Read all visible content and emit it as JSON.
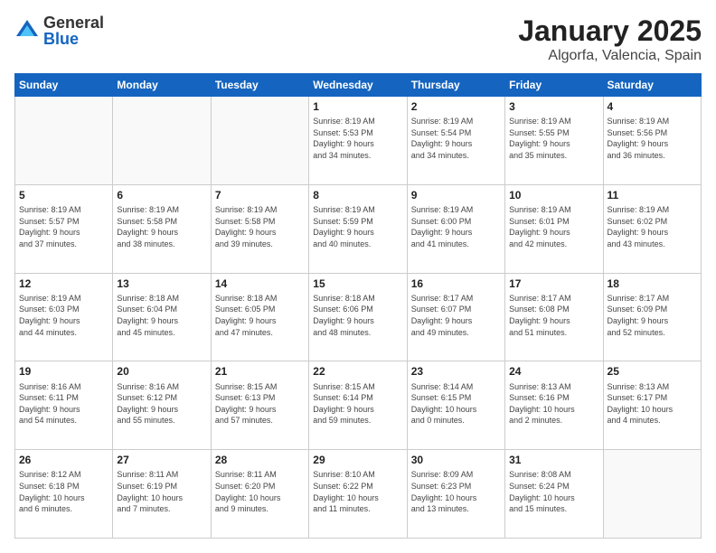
{
  "header": {
    "logo_general": "General",
    "logo_blue": "Blue",
    "month_title": "January 2025",
    "location": "Algorfa, Valencia, Spain"
  },
  "weekdays": [
    "Sunday",
    "Monday",
    "Tuesday",
    "Wednesday",
    "Thursday",
    "Friday",
    "Saturday"
  ],
  "weeks": [
    [
      {
        "day": "",
        "info": ""
      },
      {
        "day": "",
        "info": ""
      },
      {
        "day": "",
        "info": ""
      },
      {
        "day": "1",
        "info": "Sunrise: 8:19 AM\nSunset: 5:53 PM\nDaylight: 9 hours\nand 34 minutes."
      },
      {
        "day": "2",
        "info": "Sunrise: 8:19 AM\nSunset: 5:54 PM\nDaylight: 9 hours\nand 34 minutes."
      },
      {
        "day": "3",
        "info": "Sunrise: 8:19 AM\nSunset: 5:55 PM\nDaylight: 9 hours\nand 35 minutes."
      },
      {
        "day": "4",
        "info": "Sunrise: 8:19 AM\nSunset: 5:56 PM\nDaylight: 9 hours\nand 36 minutes."
      }
    ],
    [
      {
        "day": "5",
        "info": "Sunrise: 8:19 AM\nSunset: 5:57 PM\nDaylight: 9 hours\nand 37 minutes."
      },
      {
        "day": "6",
        "info": "Sunrise: 8:19 AM\nSunset: 5:58 PM\nDaylight: 9 hours\nand 38 minutes."
      },
      {
        "day": "7",
        "info": "Sunrise: 8:19 AM\nSunset: 5:58 PM\nDaylight: 9 hours\nand 39 minutes."
      },
      {
        "day": "8",
        "info": "Sunrise: 8:19 AM\nSunset: 5:59 PM\nDaylight: 9 hours\nand 40 minutes."
      },
      {
        "day": "9",
        "info": "Sunrise: 8:19 AM\nSunset: 6:00 PM\nDaylight: 9 hours\nand 41 minutes."
      },
      {
        "day": "10",
        "info": "Sunrise: 8:19 AM\nSunset: 6:01 PM\nDaylight: 9 hours\nand 42 minutes."
      },
      {
        "day": "11",
        "info": "Sunrise: 8:19 AM\nSunset: 6:02 PM\nDaylight: 9 hours\nand 43 minutes."
      }
    ],
    [
      {
        "day": "12",
        "info": "Sunrise: 8:19 AM\nSunset: 6:03 PM\nDaylight: 9 hours\nand 44 minutes."
      },
      {
        "day": "13",
        "info": "Sunrise: 8:18 AM\nSunset: 6:04 PM\nDaylight: 9 hours\nand 45 minutes."
      },
      {
        "day": "14",
        "info": "Sunrise: 8:18 AM\nSunset: 6:05 PM\nDaylight: 9 hours\nand 47 minutes."
      },
      {
        "day": "15",
        "info": "Sunrise: 8:18 AM\nSunset: 6:06 PM\nDaylight: 9 hours\nand 48 minutes."
      },
      {
        "day": "16",
        "info": "Sunrise: 8:17 AM\nSunset: 6:07 PM\nDaylight: 9 hours\nand 49 minutes."
      },
      {
        "day": "17",
        "info": "Sunrise: 8:17 AM\nSunset: 6:08 PM\nDaylight: 9 hours\nand 51 minutes."
      },
      {
        "day": "18",
        "info": "Sunrise: 8:17 AM\nSunset: 6:09 PM\nDaylight: 9 hours\nand 52 minutes."
      }
    ],
    [
      {
        "day": "19",
        "info": "Sunrise: 8:16 AM\nSunset: 6:11 PM\nDaylight: 9 hours\nand 54 minutes."
      },
      {
        "day": "20",
        "info": "Sunrise: 8:16 AM\nSunset: 6:12 PM\nDaylight: 9 hours\nand 55 minutes."
      },
      {
        "day": "21",
        "info": "Sunrise: 8:15 AM\nSunset: 6:13 PM\nDaylight: 9 hours\nand 57 minutes."
      },
      {
        "day": "22",
        "info": "Sunrise: 8:15 AM\nSunset: 6:14 PM\nDaylight: 9 hours\nand 59 minutes."
      },
      {
        "day": "23",
        "info": "Sunrise: 8:14 AM\nSunset: 6:15 PM\nDaylight: 10 hours\nand 0 minutes."
      },
      {
        "day": "24",
        "info": "Sunrise: 8:13 AM\nSunset: 6:16 PM\nDaylight: 10 hours\nand 2 minutes."
      },
      {
        "day": "25",
        "info": "Sunrise: 8:13 AM\nSunset: 6:17 PM\nDaylight: 10 hours\nand 4 minutes."
      }
    ],
    [
      {
        "day": "26",
        "info": "Sunrise: 8:12 AM\nSunset: 6:18 PM\nDaylight: 10 hours\nand 6 minutes."
      },
      {
        "day": "27",
        "info": "Sunrise: 8:11 AM\nSunset: 6:19 PM\nDaylight: 10 hours\nand 7 minutes."
      },
      {
        "day": "28",
        "info": "Sunrise: 8:11 AM\nSunset: 6:20 PM\nDaylight: 10 hours\nand 9 minutes."
      },
      {
        "day": "29",
        "info": "Sunrise: 8:10 AM\nSunset: 6:22 PM\nDaylight: 10 hours\nand 11 minutes."
      },
      {
        "day": "30",
        "info": "Sunrise: 8:09 AM\nSunset: 6:23 PM\nDaylight: 10 hours\nand 13 minutes."
      },
      {
        "day": "31",
        "info": "Sunrise: 8:08 AM\nSunset: 6:24 PM\nDaylight: 10 hours\nand 15 minutes."
      },
      {
        "day": "",
        "info": ""
      }
    ]
  ]
}
